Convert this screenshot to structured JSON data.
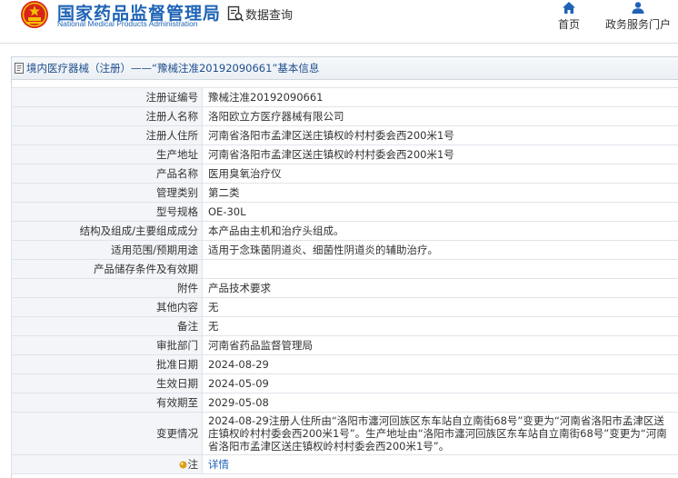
{
  "header": {
    "org_name_cn": "国家药品监督管理局",
    "org_name_en": "National Medical Products Administration",
    "query_label": "数据查询",
    "nav": [
      {
        "label": "首页",
        "icon": "home-icon"
      },
      {
        "label": "政务服务门户",
        "icon": "user-icon"
      }
    ]
  },
  "panel": {
    "title": "境内医疗器械（注册）——“豫械注准20192090661”基本信息",
    "rows": [
      {
        "label": "注册证编号",
        "value": "豫械注准20192090661"
      },
      {
        "label": "注册人名称",
        "value": "洛阳欧立方医疗器械有限公司"
      },
      {
        "label": "注册人住所",
        "value": "河南省洛阳市孟津区送庄镇权岭村村委会西200米1号"
      },
      {
        "label": "生产地址",
        "value": "河南省洛阳市孟津区送庄镇权岭村村委会西200米1号"
      },
      {
        "label": "产品名称",
        "value": "医用臭氧治疗仪"
      },
      {
        "label": "管理类别",
        "value": "第二类"
      },
      {
        "label": "型号规格",
        "value": "OE-30L"
      },
      {
        "label": "结构及组成/主要组成成分",
        "value": "本产品由主机和治疗头组成。"
      },
      {
        "label": "适用范围/预期用途",
        "value": "适用于念珠菌阴道炎、细菌性阴道炎的辅助治疗。"
      },
      {
        "label": "产品储存条件及有效期",
        "value": ""
      },
      {
        "label": "附件",
        "value": "产品技术要求"
      },
      {
        "label": "其他内容",
        "value": "无"
      },
      {
        "label": "备注",
        "value": "无"
      },
      {
        "label": "审批部门",
        "value": "河南省药品监督管理局"
      },
      {
        "label": "批准日期",
        "value": "2024-08-29"
      },
      {
        "label": "生效日期",
        "value": "2024-05-09"
      },
      {
        "label": "有效期至",
        "value": "2029-05-08"
      }
    ],
    "change": {
      "label": "变更情况",
      "value": "2024-08-29注册人住所由“洛阳市瀍河回族区东车站自立南街68号”变更为“河南省洛阳市孟津区送庄镇权岭村村委会西200米1号”。生产地址由“洛阳市瀍河回族区东车站自立南街68号”变更为“河南省洛阳市孟津区送庄镇权岭村村委会西200米1号”。"
    },
    "note": {
      "label": "注",
      "link": "详情"
    }
  },
  "colors": {
    "brand_blue": "#1e63b6",
    "emblem_red": "#d7231a",
    "emblem_gold": "#f2c200"
  }
}
